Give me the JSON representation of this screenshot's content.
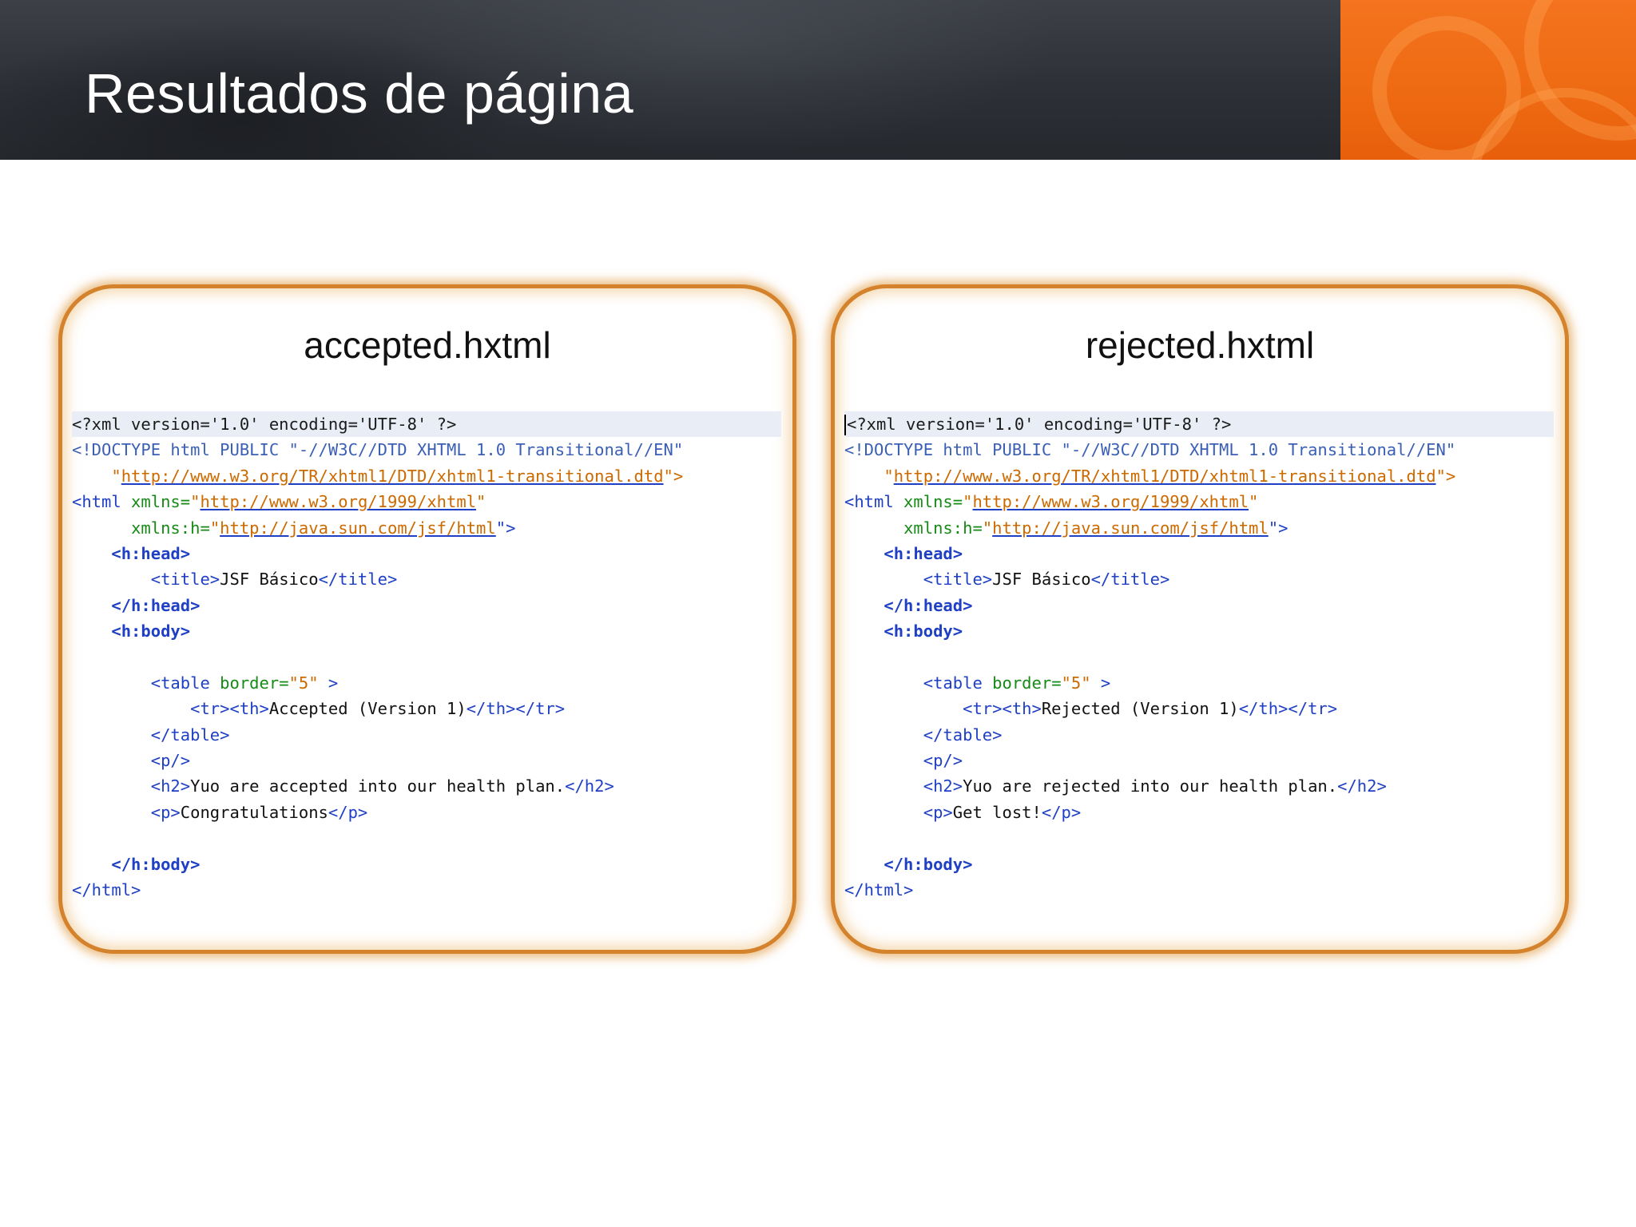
{
  "slide": {
    "title": "Resultados de página"
  },
  "panels": [
    {
      "title": "accepted.hxtml",
      "lines": {
        "l1_pi": "<?xml version='1.0' encoding='UTF-8' ?>",
        "l2_doctype": "<!DOCTYPE html PUBLIC \"-//W3C//DTD XHTML 1.0 Transitional//EN\"",
        "l3_quote_open": "    \"",
        "l3_url": "http://www.w3.org/TR/xhtml1/DTD/xhtml1-transitional.dtd",
        "l3_end": "\">",
        "l4_tag": "<html",
        "l4_attr": " xmlns=",
        "l4_q1": "\"",
        "l4_url": "http://www.w3.org/1999/xhtml",
        "l4_q2": "\"",
        "l5_indent": "      ",
        "l5_attr": "xmlns:h=",
        "l5_q1": "\"",
        "l5_url": "http://java.sun.com/jsf/html",
        "l5_end": "\">",
        "l6": "    <h:head>",
        "l7_open": "        <title>",
        "l7_text": "JSF Básico",
        "l7_close": "</title>",
        "l8": "    </h:head>",
        "l9": "    <h:body>",
        "l11_tag": "        <table",
        "l11_attr": " border=",
        "l11_val": "\"5\"",
        "l11_end": " >",
        "l12_open": "            <tr><th>",
        "l12_text": "Accepted (Version 1)",
        "l12_close": "</th></tr>",
        "l13": "        </table>",
        "l14": "        <p/>",
        "l15_open": "        <h2>",
        "l15_text": "Yuo are accepted into our health plan.",
        "l15_close": "</h2>",
        "l16_open": "        <p>",
        "l16_text": "Congratulations",
        "l16_close": "</p>",
        "l18": "    </h:body>",
        "l19": "</html>"
      }
    },
    {
      "title": "rejected.hxtml",
      "lines": {
        "l1_pi": "<?xml version='1.0' encoding='UTF-8' ?>",
        "l2_doctype": "<!DOCTYPE html PUBLIC \"-//W3C//DTD XHTML 1.0 Transitional//EN\"",
        "l3_quote_open": "    \"",
        "l3_url": "http://www.w3.org/TR/xhtml1/DTD/xhtml1-transitional.dtd",
        "l3_end": "\">",
        "l4_tag": "<html",
        "l4_attr": " xmlns=",
        "l4_q1": "\"",
        "l4_url": "http://www.w3.org/1999/xhtml",
        "l4_q2": "\"",
        "l5_indent": "      ",
        "l5_attr": "xmlns:h=",
        "l5_q1": "\"",
        "l5_url": "http://java.sun.com/jsf/html",
        "l5_end": "\">",
        "l6": "    <h:head>",
        "l7_open": "        <title>",
        "l7_text": "JSF Básico",
        "l7_close": "</title>",
        "l8": "    </h:head>",
        "l9": "    <h:body>",
        "l11_tag": "        <table",
        "l11_attr": " border=",
        "l11_val": "\"5\"",
        "l11_end": " >",
        "l12_open": "            <tr><th>",
        "l12_text": "Rejected (Version 1)",
        "l12_close": "</th></tr>",
        "l13": "        </table>",
        "l14": "        <p/>",
        "l15_open": "        <h2>",
        "l15_text": "Yuo are rejected into our health plan.",
        "l15_close": "</h2>",
        "l16_open": "        <p>",
        "l16_text": "Get lost!",
        "l16_close": "</p>",
        "l18": "    </h:body>",
        "l19": "</html>"
      }
    }
  ]
}
